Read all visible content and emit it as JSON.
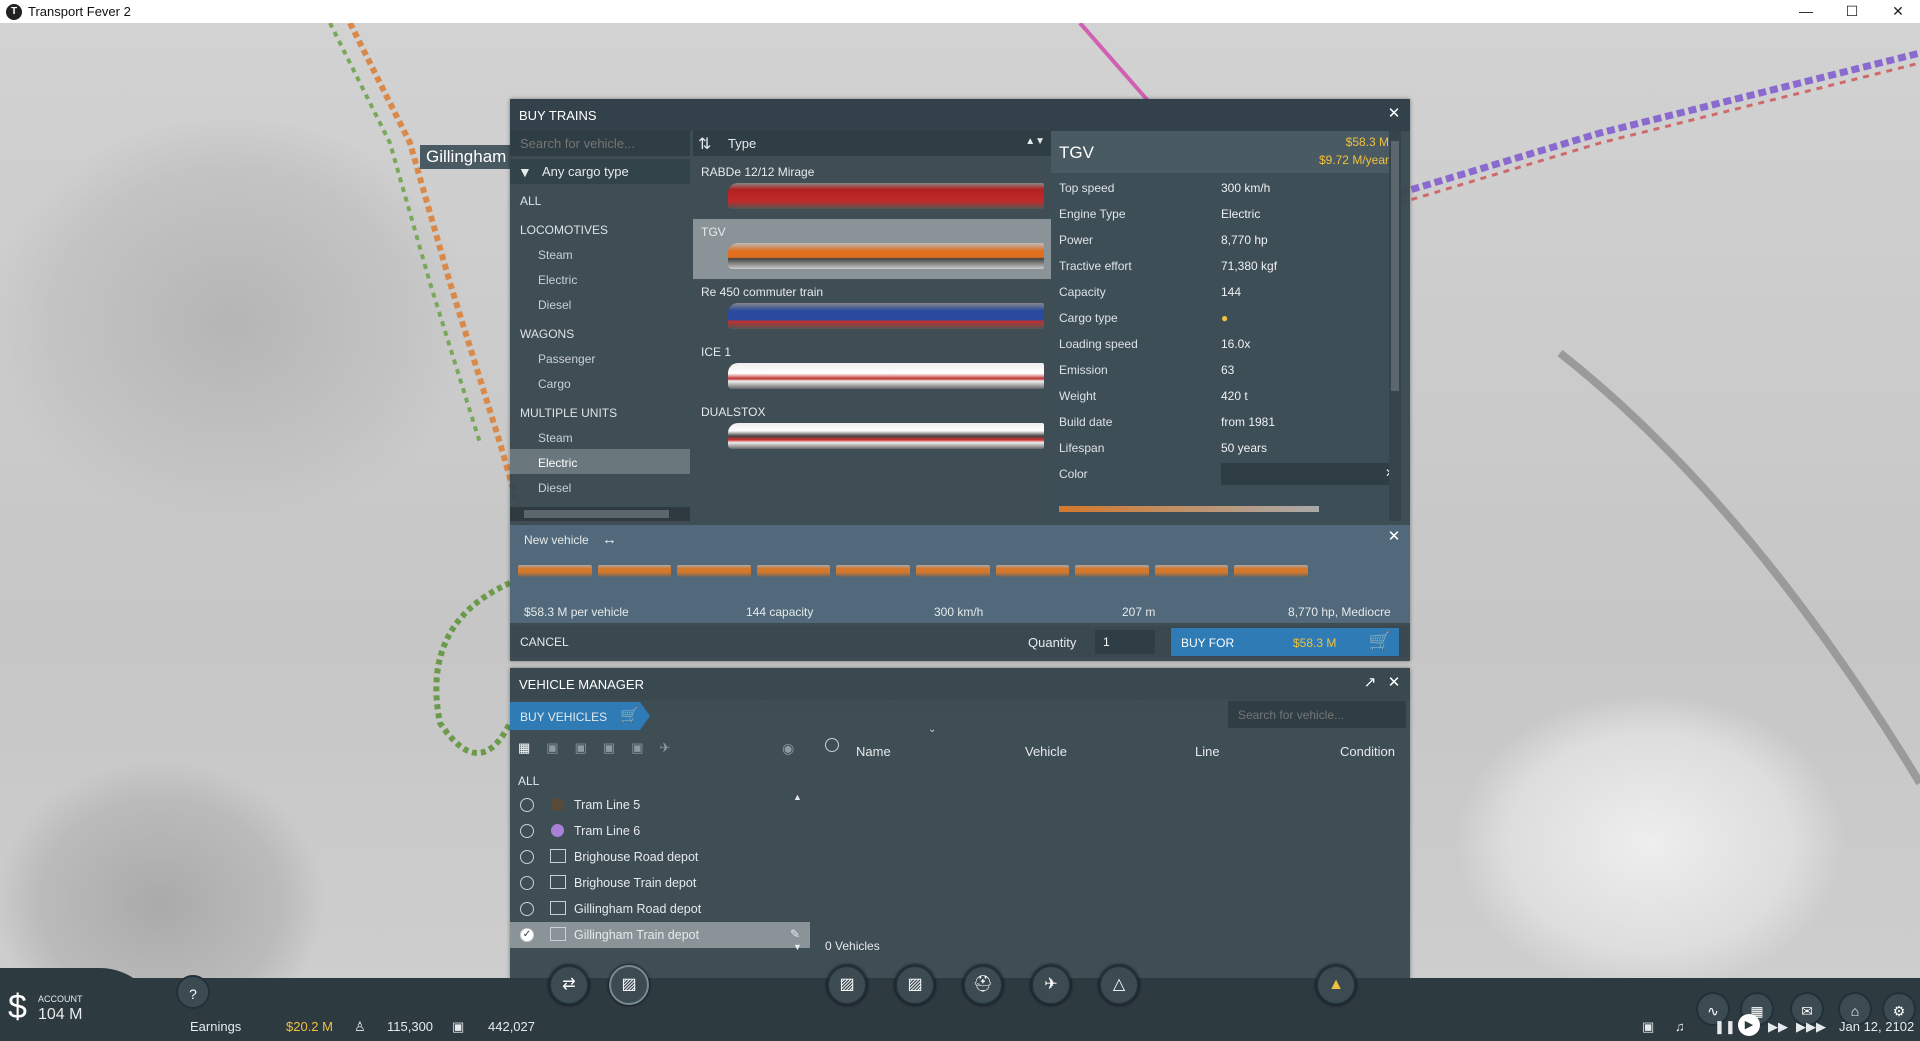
{
  "window": {
    "title": "Transport Fever 2"
  },
  "map": {
    "town_label": "Gillingham"
  },
  "buy_trains": {
    "title": "BUY TRAINS",
    "search_placeholder": "Search for vehicle...",
    "cargo_filter": "Any cargo type",
    "categories": {
      "all": "ALL",
      "locomotives": "LOCOMOTIVES",
      "loco_steam": "Steam",
      "loco_electric": "Electric",
      "loco_diesel": "Diesel",
      "wagons": "WAGONS",
      "wagon_passenger": "Passenger",
      "wagon_cargo": "Cargo",
      "multiple_units": "MULTIPLE UNITS",
      "mu_steam": "Steam",
      "mu_electric": "Electric",
      "mu_diesel": "Diesel"
    },
    "sort_label": "Type",
    "vehicles": [
      "RABDe 12/12 Mirage",
      "TGV",
      "Re 450 commuter train",
      "ICE 1",
      "DUALSTOX"
    ],
    "detail": {
      "name": "TGV",
      "price": "$58.3 M",
      "running_cost": "$9.72 M/year",
      "specs": [
        {
          "k": "Top speed",
          "v": "300 km/h"
        },
        {
          "k": "Engine Type",
          "v": "Electric"
        },
        {
          "k": "Power",
          "v": "8,770 hp"
        },
        {
          "k": "Tractive effort",
          "v": "71,380 kgf"
        },
        {
          "k": "Capacity",
          "v": "144"
        },
        {
          "k": "Cargo type",
          "v": ""
        },
        {
          "k": "Loading speed",
          "v": "16.0x"
        },
        {
          "k": "Emission",
          "v": "63"
        },
        {
          "k": "Weight",
          "v": "420 t"
        },
        {
          "k": "Build date",
          "v": "from 1981"
        },
        {
          "k": "Lifespan",
          "v": "50 years"
        },
        {
          "k": "Color",
          "v": ""
        }
      ]
    },
    "new_vehicle": {
      "label": "New vehicle",
      "price": "$58.3 M per vehicle",
      "capacity": "144 capacity",
      "speed": "300 km/h",
      "length": "207 m",
      "power": "8,770 hp, Mediocre"
    },
    "cancel": "CANCEL",
    "quantity_label": "Quantity",
    "quantity": "1",
    "buy_label": "BUY FOR",
    "buy_price": "$58.3 M"
  },
  "vehicle_manager": {
    "title": "VEHICLE MANAGER",
    "buy_vehicles": "BUY VEHICLES",
    "search_placeholder": "Search for vehicle...",
    "columns": {
      "name": "Name",
      "vehicle": "Vehicle",
      "line": "Line",
      "condition": "Condition"
    },
    "filter_all": "ALL",
    "items": [
      "Tram Line 5",
      "Tram Line 6",
      "Brighouse Road depot",
      "Brighouse Train depot",
      "Gillingham Road depot",
      "Gillingham Train depot"
    ],
    "vehicles_count": "0 Vehicles"
  },
  "status": {
    "account_label": "ACCOUNT",
    "account": "104 M",
    "earnings_label": "Earnings",
    "earnings": "$20.2 M",
    "population": "115,300",
    "cargo": "442,027",
    "date": "Jan 12, 2102"
  },
  "colors": {
    "accent": "#2e7bb5",
    "money": "#f0c040",
    "panel": "#3a4850"
  }
}
